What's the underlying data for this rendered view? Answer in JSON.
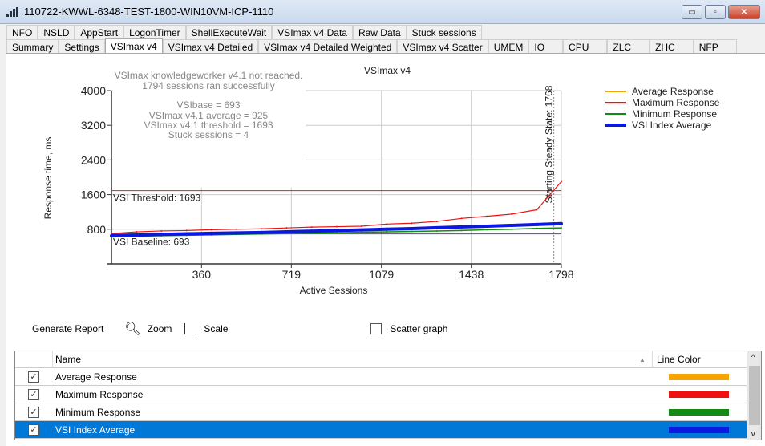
{
  "window": {
    "title": "110722-KWWL-6348-TEST-1800-WIN10VM-ICP-1110",
    "minimize": "▭",
    "maximize": "▫",
    "close": "✕"
  },
  "tabs_row1": [
    "NFO",
    "NSLD",
    "AppStart",
    "LogonTimer",
    "ShellExecuteWait",
    "VSImax v4 Data",
    "Raw Data",
    "Stuck sessions"
  ],
  "tabs_row2": [
    "Summary",
    "Settings",
    "VSImax v4",
    "VSImax v4 Detailed",
    "VSImax v4 Detailed Weighted",
    "VSImax v4 Scatter",
    "UMEM",
    "IO",
    "CPU",
    "ZLC",
    "ZHC",
    "NFP"
  ],
  "active_tab": "VSImax v4",
  "chart_data": {
    "type": "line",
    "title": "VSImax v4",
    "xlabel": "Active Sessions",
    "ylabel": "Response time, ms",
    "xlim": [
      0,
      1798
    ],
    "ylim": [
      0,
      4000
    ],
    "xticks": [
      360,
      719,
      1079,
      1438,
      1798
    ],
    "yticks": [
      800,
      1600,
      2400,
      3200,
      4000
    ],
    "grid": true,
    "legend_position": "right",
    "annotations": [
      "VSImax knowledgeworker v4.1 not reached.",
      "1794 sessions ran successfully",
      "VSIbase = 693",
      "VSImax v4.1 average = 925",
      "VSImax v4.1 threshold = 1693",
      "Stuck sessions = 4"
    ],
    "threshold": {
      "label": "VSI Threshold: 1693",
      "value": 1693,
      "color": "#e02020"
    },
    "baseline": {
      "label": "VSI Baseline: 693",
      "value": 693,
      "color": "#3050d0"
    },
    "steady_state": {
      "label": "Starting Steady State: 1768",
      "value": 1768
    },
    "x": [
      0,
      100,
      200,
      300,
      400,
      500,
      600,
      700,
      800,
      900,
      1000,
      1100,
      1200,
      1300,
      1400,
      1500,
      1600,
      1700,
      1798
    ],
    "series": [
      {
        "name": "Average Response",
        "color": "#f5a300",
        "values": [
          660,
          675,
          690,
          700,
          712,
          722,
          732,
          748,
          762,
          778,
          792,
          810,
          825,
          845,
          865,
          880,
          900,
          920,
          940
        ]
      },
      {
        "name": "Maximum Response",
        "color": "#ee1111",
        "values": [
          700,
          740,
          760,
          770,
          790,
          800,
          810,
          830,
          850,
          860,
          870,
          920,
          940,
          980,
          1050,
          1100,
          1150,
          1250,
          1900
        ]
      },
      {
        "name": "Minimum Response",
        "color": "#138a13",
        "values": [
          620,
          640,
          650,
          660,
          670,
          680,
          690,
          700,
          710,
          720,
          730,
          740,
          750,
          760,
          770,
          790,
          800,
          820,
          830
        ]
      },
      {
        "name": "VSI Index Average",
        "color": "#0b18e0",
        "values": [
          650,
          665,
          680,
          695,
          705,
          715,
          725,
          740,
          755,
          770,
          785,
          800,
          815,
          835,
          855,
          870,
          890,
          910,
          930
        ]
      }
    ]
  },
  "toolbar": {
    "generate_report": "Generate Report",
    "zoom": "Zoom",
    "scale": "Scale",
    "scatter_graph": "Scatter graph",
    "scatter_checked": false
  },
  "grid": {
    "col_name": "Name",
    "col_color": "Line Color",
    "rows": [
      {
        "name": "Average Response",
        "checked": true,
        "color": "#f5a300"
      },
      {
        "name": "Maximum Response",
        "checked": true,
        "color": "#ee1111"
      },
      {
        "name": "Minimum Response",
        "checked": true,
        "color": "#138a13"
      },
      {
        "name": "VSI Index Average",
        "checked": true,
        "color": "#0b18e0",
        "selected": true
      }
    ]
  }
}
